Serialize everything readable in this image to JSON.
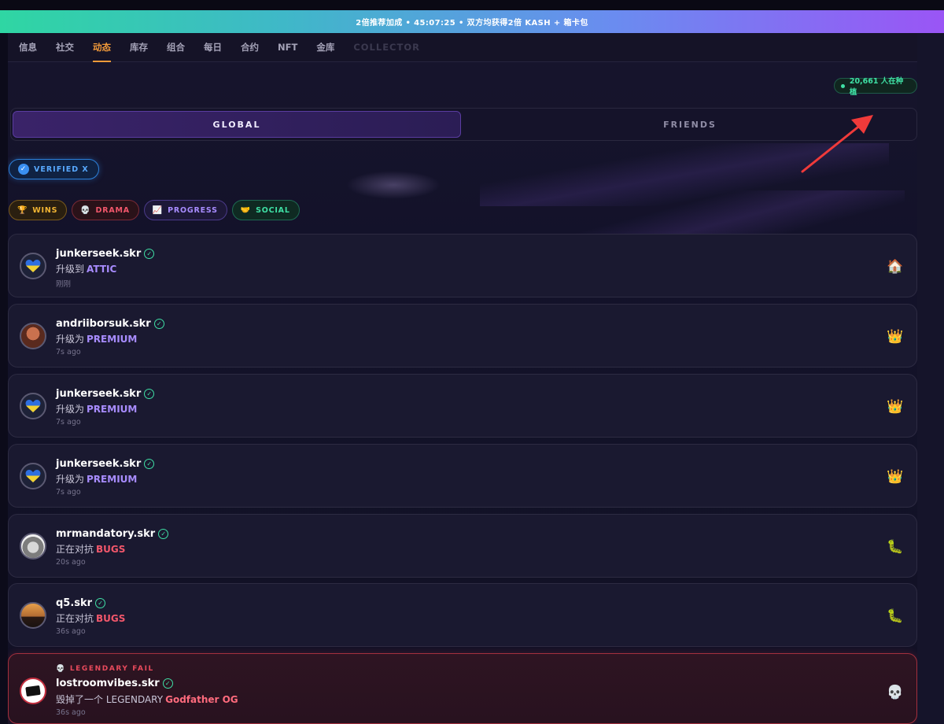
{
  "banner": {
    "text": "2倍推荐加成 • 45:07:25 • 双方均获得2倍 KASH + 箱卡包"
  },
  "tabs": [
    {
      "label": "信息"
    },
    {
      "label": "社交"
    },
    {
      "label": "动态"
    },
    {
      "label": "库存"
    },
    {
      "label": "组合"
    },
    {
      "label": "每日"
    },
    {
      "label": "合约"
    },
    {
      "label": "NFT"
    },
    {
      "label": "金库"
    },
    {
      "label": "COLLECTOR"
    }
  ],
  "active_tab": "动态",
  "online": {
    "text": "20,661 人在种植"
  },
  "segment": {
    "global": "GLOBAL",
    "friends": "FRIENDS"
  },
  "verified_filter": {
    "label": "VERIFIED X"
  },
  "filters": {
    "wins": "WINS",
    "drama": "DRAMA",
    "progress": "PROGRESS",
    "social": "SOCIAL"
  },
  "feed": [
    {
      "user": "junkerseek.skr",
      "action": "升级到",
      "highlight": "ATTIC",
      "time": "刚刚",
      "icon": "house-icon"
    },
    {
      "user": "andriiborsuk.skr",
      "action": "升级为",
      "highlight": "PREMIUM",
      "time": "7s ago",
      "icon": "crown-icon"
    },
    {
      "user": "junkerseek.skr",
      "action": "升级为",
      "highlight": "PREMIUM",
      "time": "7s ago",
      "icon": "crown-icon"
    },
    {
      "user": "junkerseek.skr",
      "action": "升级为",
      "highlight": "PREMIUM",
      "time": "7s ago",
      "icon": "crown-icon"
    },
    {
      "user": "mrmandatory.skr",
      "action": "正在对抗",
      "highlight": "BUGS",
      "time": "20s ago",
      "icon": "bug-icon"
    },
    {
      "user": "q5.skr",
      "action": "正在对抗",
      "highlight": "BUGS",
      "time": "36s ago",
      "icon": "bug-icon"
    },
    {
      "tag": "LEGENDARY FAIL",
      "user": "lostroomvibes.skr",
      "action": "毁掉了一个 LEGENDARY",
      "highlight": "Godfather OG",
      "time": "36s ago",
      "icon": "skull-icon"
    }
  ],
  "colors": {
    "accent_tab": "#f29a3a",
    "verified": "#3fe0a5",
    "highlight_purple": "#a88cff",
    "highlight_red": "#f2576b",
    "legendary_border": "#a3303e"
  }
}
